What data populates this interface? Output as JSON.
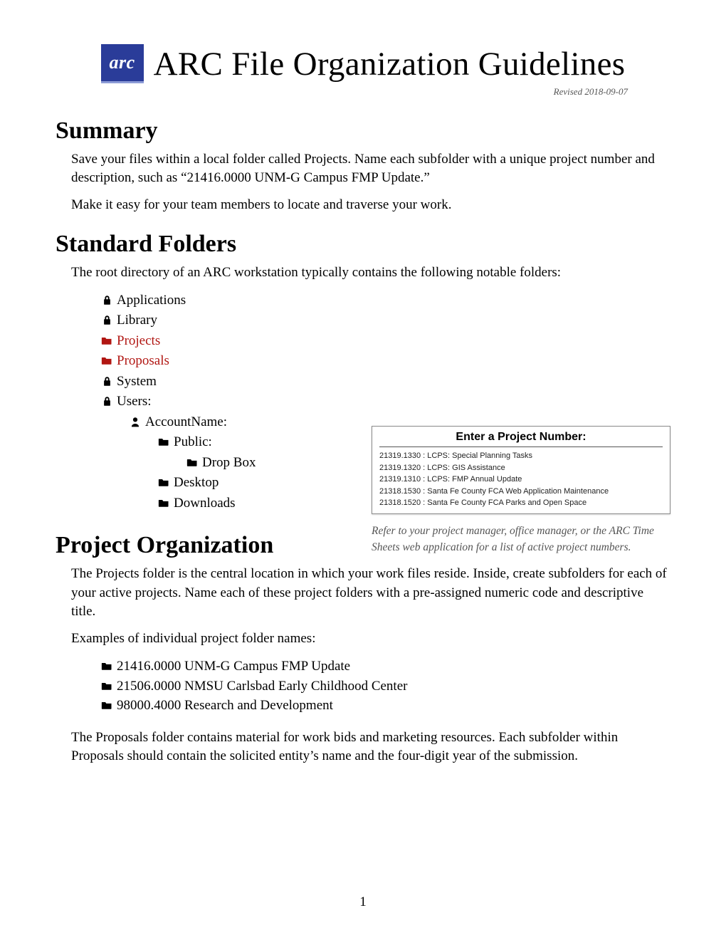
{
  "header": {
    "logo_text": "arc",
    "title": "ARC File Organization Guidelines",
    "revised": "Revised 2018-09-07"
  },
  "summary": {
    "heading": "Summary",
    "p1": "Save your files within a local folder called Projects.  Name each subfolder with a unique project number and description, such as “21416.0000 UNM-G Campus FMP Update.”",
    "p2": "Make it easy for your team members to locate and traverse your work."
  },
  "standard": {
    "heading": "Standard Folders",
    "intro": "The root directory of an ARC workstation typically contains the following notable folders:",
    "items": {
      "applications": "Applications",
      "library": "Library",
      "projects": "Projects",
      "proposals": "Proposals",
      "system": "System",
      "users": "Users:",
      "account": "AccountName:",
      "public": "Public:",
      "dropbox": "Drop Box",
      "desktop": "Desktop",
      "downloads": "Downloads"
    }
  },
  "sidebar": {
    "enter_label": "Enter a Project Number:",
    "rows": [
      "21319.1330 : LCPS: Special Planning Tasks",
      "21319.1320 : LCPS: GIS Assistance",
      "21319.1310 : LCPS: FMP Annual Update",
      "21318.1530 : Santa Fe County FCA Web Application Maintenance",
      "21318.1520 : Santa Fe County FCA Parks and Open Space"
    ],
    "caption": "Refer to your project manager, office manager, or the ARC Time Sheets web application for a list of active project numbers."
  },
  "project_org": {
    "heading": "Project Organization",
    "p1": "The Projects folder is the central location in which your work files reside.  Inside, create subfolders for each of your active projects.  Name each of these project folders with a pre-assigned numeric code and descriptive title.",
    "examples_label": "Examples of individual project folder names:",
    "examples": [
      "21416.0000 UNM-G Campus FMP Update",
      "21506.0000 NMSU Carlsbad Early Childhood Center",
      "98000.4000 Research and Development"
    ],
    "p2": "The Proposals folder contains material for work bids and marketing resources.  Each subfolder within Proposals should contain the solicited entity’s name and the four-digit year of the submission."
  },
  "page_number": "1"
}
